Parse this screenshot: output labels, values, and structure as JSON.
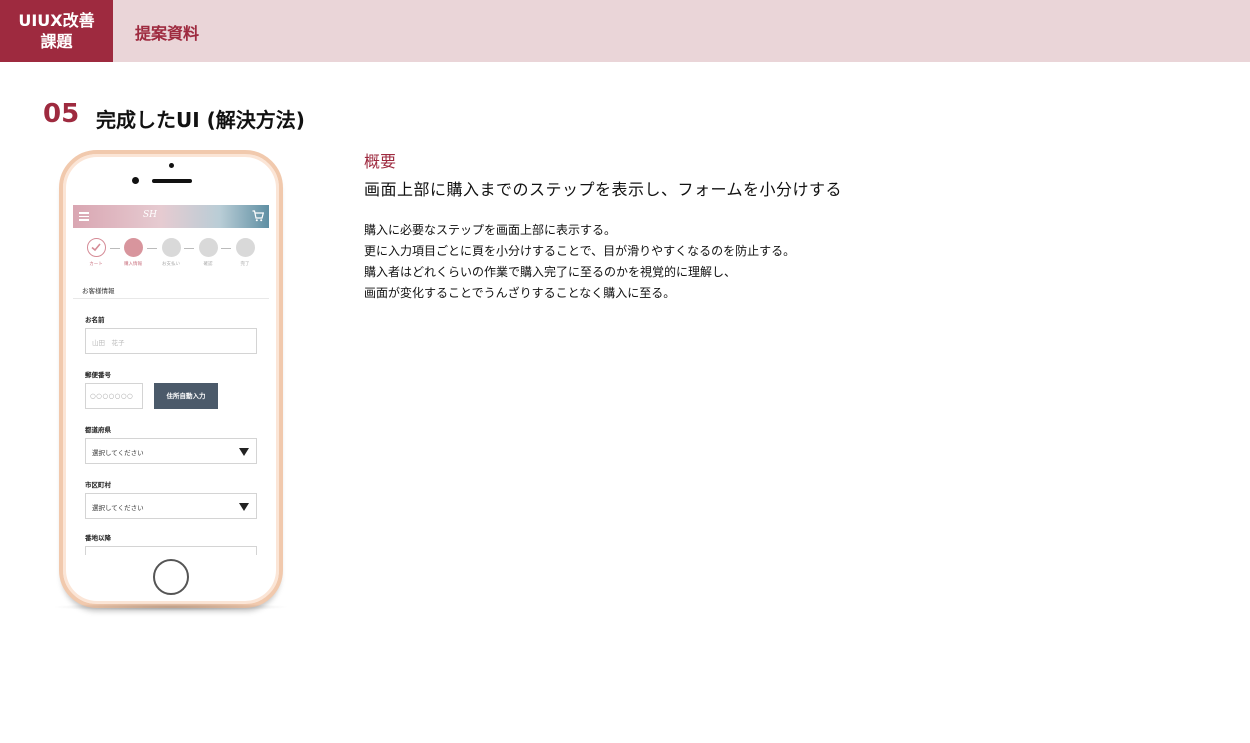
{
  "header": {
    "badge_line1": "UIUX改善",
    "badge_line2": "課題",
    "title": "提案資料"
  },
  "section": {
    "number": "05",
    "title": "完成したUI (解決方法)"
  },
  "phone": {
    "app_logo": "SH",
    "steps": [
      {
        "label": "カート",
        "state": "done"
      },
      {
        "label": "購入情報",
        "state": "current"
      },
      {
        "label": "お支払い",
        "state": "todo"
      },
      {
        "label": "確認",
        "state": "todo"
      },
      {
        "label": "完了",
        "state": "todo"
      }
    ],
    "section_heading": "お客様情報",
    "form": {
      "name_label": "お名前",
      "name_placeholder": "山田　花子",
      "zip_label": "郵便番号",
      "zip_placeholder": "○○○○○○○",
      "zip_button": "住所自動入力",
      "pref_label": "都道府県",
      "pref_value": "選択してください",
      "city_label": "市区町村",
      "city_value": "選択してください",
      "address_label": "番地以降"
    }
  },
  "overview": {
    "label": "概要",
    "lead": "画面上部に購入までのステップを表示し、フォームを小分けする",
    "body": [
      "購入に必要なステップを画面上部に表示する。",
      "更に入力項目ごとに頁を小分けすることで、目が滑りやすくなるのを防止する。",
      "購入者はどれくらいの作業で購入完了に至るのかを視覚的に理解し、",
      "画面が変化することでうんざりすることなく購入に至る。"
    ]
  },
  "colors": {
    "accent": "#9e2a3f",
    "header_band": "#ead5d8",
    "step_active": "#d8959d",
    "button_dark": "#4b5a6a"
  }
}
